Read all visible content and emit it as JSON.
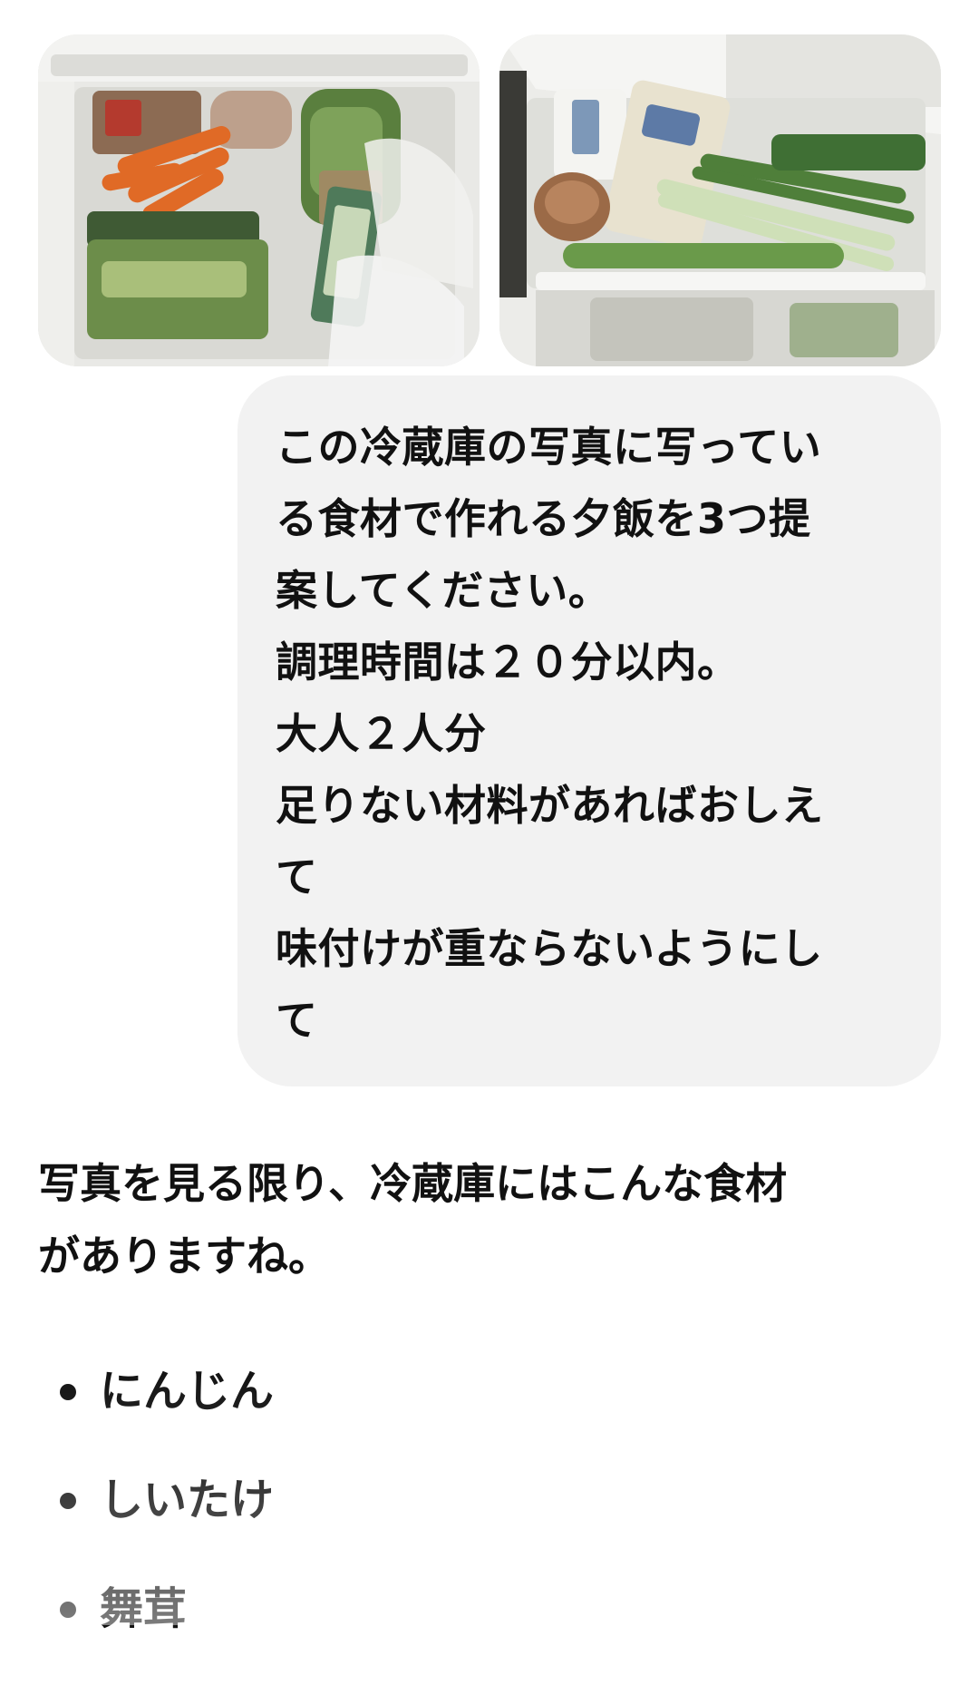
{
  "attachments": [
    {
      "name": "fridge-photo-1"
    },
    {
      "name": "fridge-photo-2"
    }
  ],
  "user_message": {
    "lines": [
      "この冷蔵庫の写真に写ってい",
      "る食材で作れる夕飯を3つ提",
      "案してください。",
      "調理時間は２０分以内。",
      "大人２人分",
      "足りない材料があればおしえ",
      "て",
      "味付けが重ならないようにし",
      "て"
    ]
  },
  "assistant_message": {
    "intro_lines": [
      "写真を見る限り、冷蔵庫にはこんな食材",
      "がありますね。"
    ],
    "ingredients": [
      "にんじん",
      "しいたけ",
      "舞茸"
    ]
  }
}
